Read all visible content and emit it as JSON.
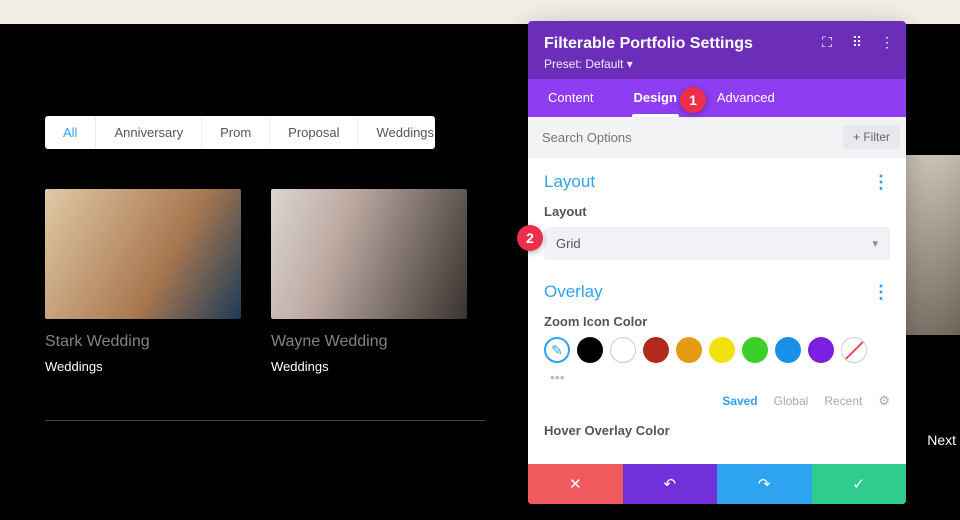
{
  "page": {
    "filters": [
      "All",
      "Anniversary",
      "Prom",
      "Proposal",
      "Weddings"
    ],
    "active_filter": "All",
    "cards": [
      {
        "title": "Stark Wedding",
        "category": "Weddings"
      },
      {
        "title": "Wayne Wedding",
        "category": "Weddings"
      }
    ],
    "next_label": "Next"
  },
  "panel": {
    "title": "Filterable Portfolio Settings",
    "preset_label": "Preset: Default",
    "tabs": {
      "content": "Content",
      "design": "Design",
      "advanced": "Advanced"
    },
    "search_placeholder": "Search Options",
    "filter_btn": "Filter",
    "sections": {
      "layout": {
        "title": "Layout",
        "field_label": "Layout",
        "value": "Grid"
      },
      "overlay": {
        "title": "Overlay",
        "zoom_label": "Zoom Icon Color",
        "hover_label": "Hover Overlay Color",
        "color_tabs": {
          "saved": "Saved",
          "global": "Global",
          "recent": "Recent"
        },
        "swatches": [
          "#000000",
          "#ffffff",
          "#b02a1d",
          "#e59a12",
          "#f2e20a",
          "#3bcf2a",
          "#1a8fe6",
          "#7b1fe0"
        ]
      }
    },
    "callouts": {
      "one": "1",
      "two": "2"
    }
  }
}
